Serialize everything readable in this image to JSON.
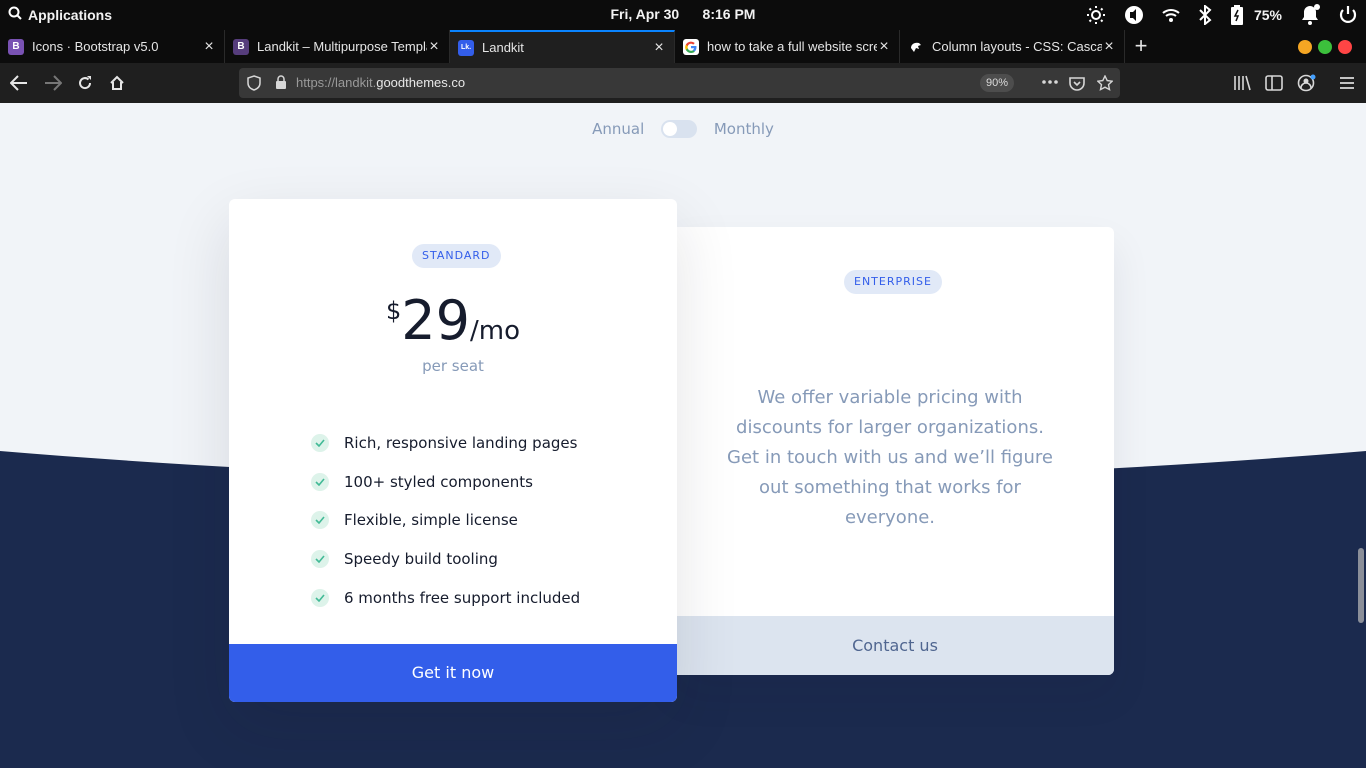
{
  "system": {
    "apps_label": "Applications",
    "clock": "Fri, Apr 30      8:16 PM",
    "battery": "75%"
  },
  "tabs": [
    {
      "title": "Icons · Bootstrap v5.0",
      "favicon": "B",
      "favicon_color": "#7952b3"
    },
    {
      "title": "Landkit – Multipurpose Template",
      "favicon": "B",
      "favicon_color": "#563d7c"
    },
    {
      "title": "Landkit",
      "favicon": "Lk.",
      "favicon_color": "#335eea"
    },
    {
      "title": "how to take a full website screenshot",
      "favicon": "G",
      "favicon_color": "#ffffff"
    },
    {
      "title": "Column layouts - CSS: Cascading",
      "favicon": "",
      "favicon_color": "#000000"
    }
  ],
  "navbar": {
    "url_prefix": "https://landkit.",
    "url_domain": "goodthemes.co",
    "zoom": "90%"
  },
  "page": {
    "toggle": {
      "left_label": "Annual",
      "right_label": "Monthly",
      "on": false
    },
    "standard": {
      "badge": "STANDARD",
      "currency": "$",
      "amount": "29",
      "period": "/mo",
      "per_seat": "per seat",
      "features": [
        "Rich, responsive landing pages",
        "100+ styled components",
        "Flexible, simple license",
        "Speedy build tooling",
        "6 months free support included"
      ],
      "button": "Get it now"
    },
    "enterprise": {
      "badge": "ENTERPRISE",
      "description": "We offer variable pricing with discounts for larger organizations. Get in touch with us and we’ll figure out something that works for everyone.",
      "button": "Contact us"
    }
  },
  "colors": {
    "primary": "#335eea",
    "navy": "#1b2a4e",
    "page_bg": "#f1f4f8"
  }
}
